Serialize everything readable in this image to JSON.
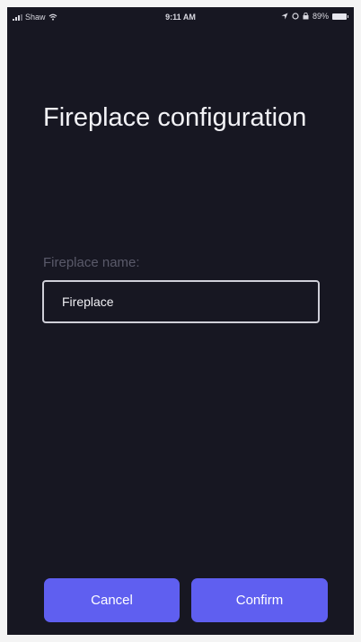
{
  "status_bar": {
    "carrier": "Shaw",
    "time": "9:11 AM",
    "battery_percent": "89%"
  },
  "screen": {
    "title": "Fireplace configuration",
    "name_field": {
      "label": "Fireplace name:",
      "value": "Fireplace"
    }
  },
  "actions": {
    "cancel_label": "Cancel",
    "confirm_label": "Confirm"
  },
  "colors": {
    "background": "#171722",
    "accent": "#5f5ff0",
    "label_muted": "#5a5a6a"
  }
}
